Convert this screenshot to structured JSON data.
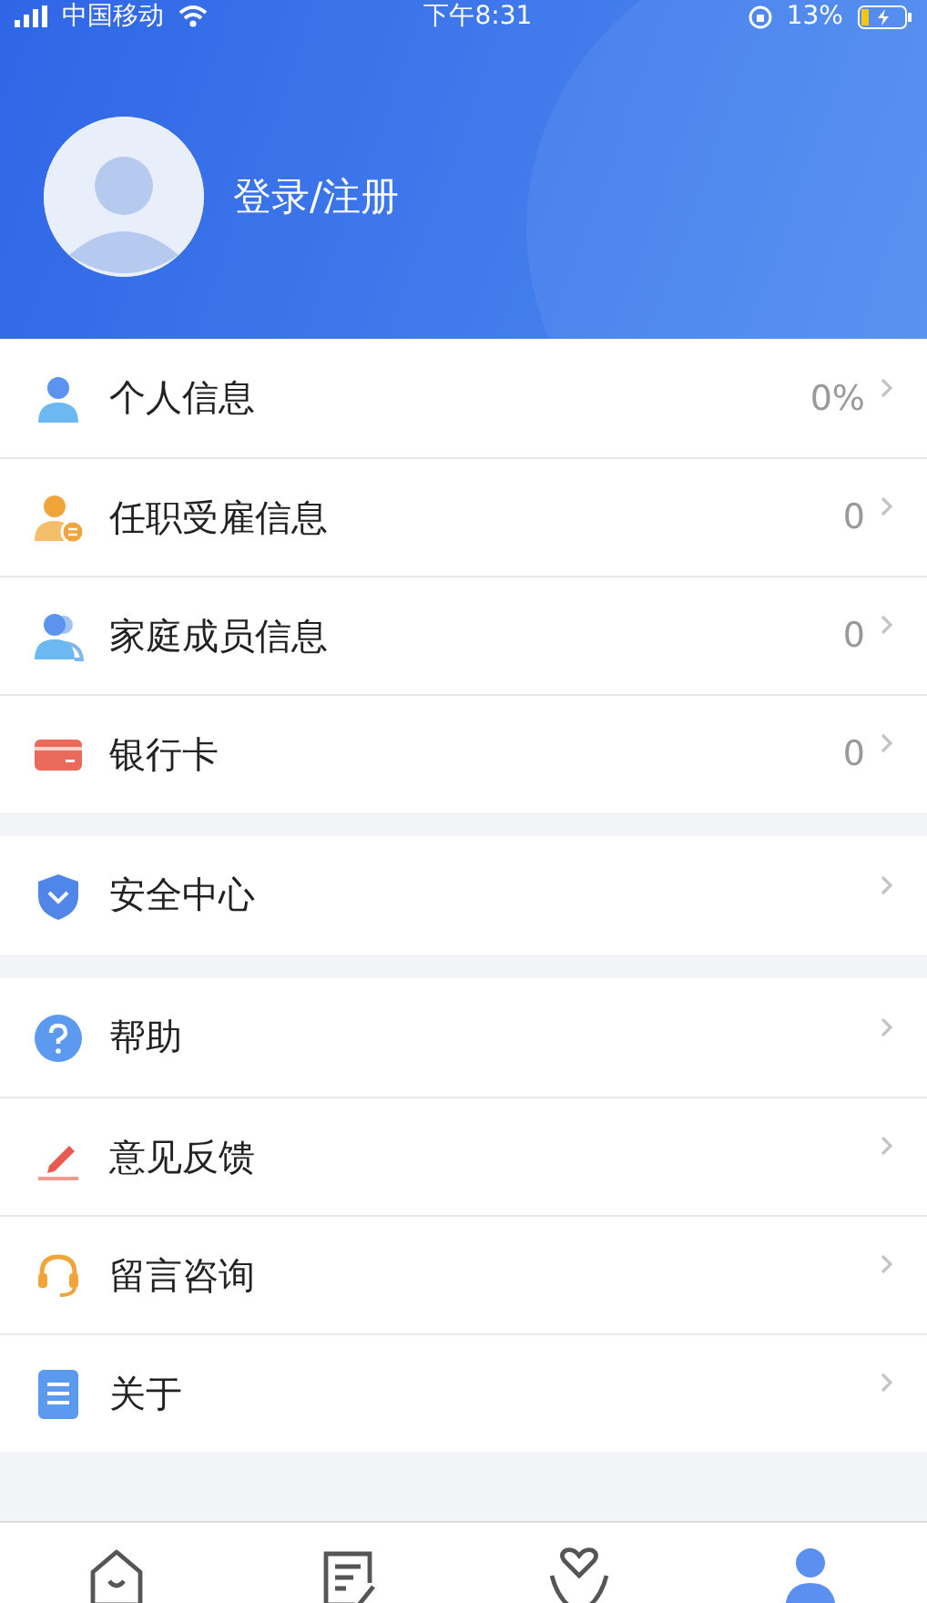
{
  "status_bar": {
    "carrier": "中国移动",
    "time": "下午8:31",
    "battery": "13%"
  },
  "profile": {
    "login_label": "登录/注册"
  },
  "groups": [
    {
      "items": [
        {
          "kind": "person",
          "label": "个人信息",
          "value": "0%"
        },
        {
          "kind": "employment",
          "label": "任职受雇信息",
          "value": "0"
        },
        {
          "kind": "family",
          "label": "家庭成员信息",
          "value": "0"
        },
        {
          "kind": "card",
          "label": "银行卡",
          "value": "0"
        }
      ]
    },
    {
      "items": [
        {
          "kind": "shield",
          "label": "安全中心"
        }
      ]
    },
    {
      "items": [
        {
          "kind": "help",
          "label": "帮助"
        },
        {
          "kind": "pen",
          "label": "意见反馈"
        },
        {
          "kind": "headset",
          "label": "留言咨询"
        },
        {
          "kind": "doc",
          "label": "关于"
        }
      ]
    }
  ],
  "tab_bar": {
    "tabs": [
      {
        "kind": "home",
        "selected": false
      },
      {
        "kind": "notes",
        "selected": false
      },
      {
        "kind": "care",
        "selected": false
      },
      {
        "kind": "me",
        "selected": true
      }
    ]
  }
}
